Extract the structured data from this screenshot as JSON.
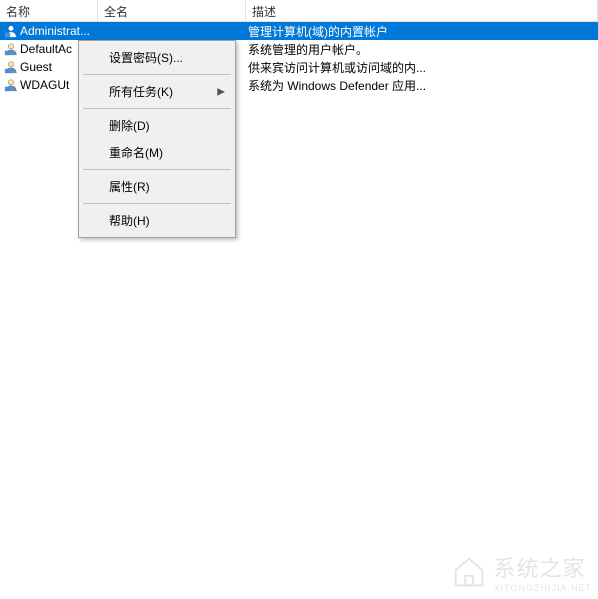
{
  "columns": {
    "name": "名称",
    "fullname": "全名",
    "desc": "描述"
  },
  "users": [
    {
      "name": "Administrat...",
      "fullname": "",
      "desc": "管理计算机(域)的内置帐户",
      "selected": true
    },
    {
      "name": "DefaultAc",
      "fullname": "",
      "desc": "系统管理的用户帐户。",
      "selected": false
    },
    {
      "name": "Guest",
      "fullname": "",
      "desc": "供来宾访问计算机或访问域的内...",
      "selected": false
    },
    {
      "name": "WDAGUt",
      "fullname": "",
      "desc": "系统为 Windows Defender 应用...",
      "selected": false
    }
  ],
  "menu": {
    "set_password": "设置密码(S)...",
    "all_tasks": "所有任务(K)",
    "delete": "删除(D)",
    "rename": "重命名(M)",
    "properties": "属性(R)",
    "help": "帮助(H)"
  },
  "watermark": {
    "title": "系统之家",
    "sub": "XITONGZHIJIA.NET"
  }
}
